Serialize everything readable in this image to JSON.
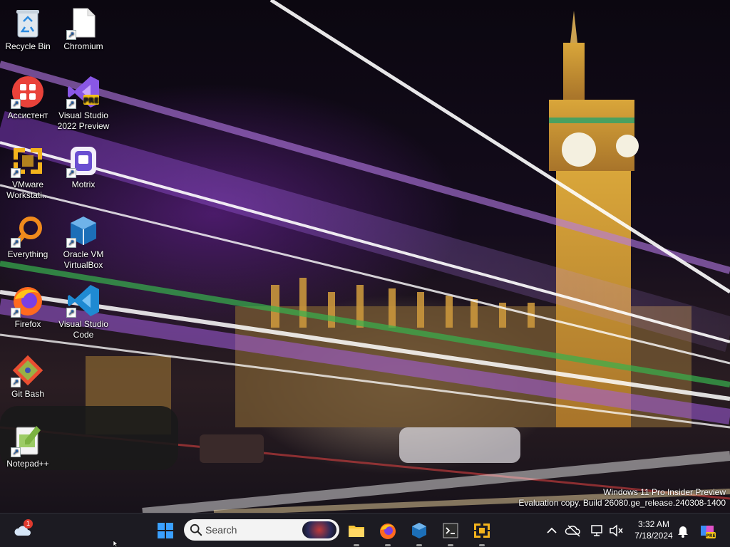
{
  "desktop": {
    "icons": [
      {
        "label": "Recycle Bin",
        "icon": "recycle-bin-icon",
        "shortcut": false
      },
      {
        "label": "Chromium",
        "icon": "chromium-file-icon",
        "shortcut": true
      },
      {
        "label": "Ассистент",
        "icon": "assistant-icon",
        "shortcut": true
      },
      {
        "label": "Visual Studio\n2022 Preview",
        "icon": "visual-studio-preview-icon",
        "shortcut": true,
        "badge": "PRE"
      },
      {
        "label": "VMware\nWorkstati...",
        "icon": "vmware-workstation-icon",
        "shortcut": true
      },
      {
        "label": "Motrix",
        "icon": "motrix-icon",
        "shortcut": true
      },
      {
        "label": "Everything",
        "icon": "everything-search-icon",
        "shortcut": true
      },
      {
        "label": "Oracle VM\nVirtualBox",
        "icon": "virtualbox-icon",
        "shortcut": true
      },
      {
        "label": "Firefox",
        "icon": "firefox-icon",
        "shortcut": true
      },
      {
        "label": "Visual Studio\nCode",
        "icon": "vscode-icon",
        "shortcut": true
      },
      {
        "label": "Git Bash",
        "icon": "git-bash-icon",
        "shortcut": true
      },
      {
        "label": "Notepad++",
        "icon": "notepad-plus-plus-icon",
        "shortcut": true
      }
    ],
    "watermark_line1": "Windows 11 Pro Insider Preview",
    "watermark_line2": "Evaluation copy. Build 26080.ge_release.240308-1400"
  },
  "taskbar": {
    "weather_badge": "1",
    "search_placeholder": "Search",
    "pinned": [
      "windows-start-icon",
      "file-explorer-icon",
      "firefox-icon",
      "virtualbox-icon",
      "terminal-icon",
      "vmware-icon"
    ],
    "clock_time": "3:32 AM",
    "clock_date": "7/18/2024",
    "copilot_badge": "PRE"
  },
  "colors": {
    "taskbar_bg": "#1c1b22",
    "accent_blue": "#0078d4",
    "wallpaper_purple": "#7a2fb0"
  }
}
